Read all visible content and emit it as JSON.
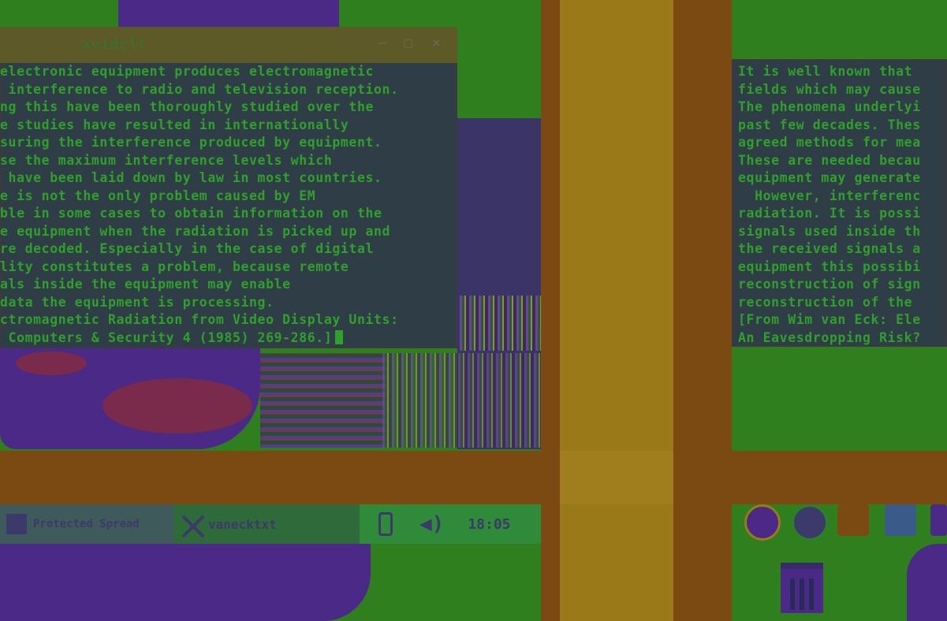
{
  "left_terminal": {
    "title": "xvidclt",
    "minimize_label": "–",
    "maximize_label": "▢",
    "close_label": "×",
    "lines": [
      "electronic equipment produces electromagnetic",
      " interference to radio and television reception.",
      "ng this have been thoroughly studied over the",
      "e studies have resulted in internationally",
      "suring the interference produced by equipment.",
      "se the maximum interference levels which",
      " have been laid down by law in most countries.",
      "e is not the only problem caused by EM",
      "ble in some cases to obtain information on the",
      "e equipment when the radiation is picked up and",
      "re decoded. Especially in the case of digital",
      "lity constitutes a problem, because remote",
      "als inside the equipment may enable",
      "data the equipment is processing.",
      "ctromagnetic Radiation from Video Display Units:",
      " Computers & Security 4 (1985) 269-286.]"
    ]
  },
  "right_terminal": {
    "lines": [
      "It is well known that",
      "fields which may cause",
      "The phenomena underlyi",
      "past few decades. Thes",
      "agreed methods for mea",
      "These are needed becau",
      "equipment may generate",
      "  However, interferenc",
      "radiation. It is possi",
      "signals used inside th",
      "the received signals a",
      "equipment this possibi",
      "reconstruction of sign",
      "reconstruction of the",
      "[From Wim van Eck: Ele",
      "An Eavesdropping Risk?"
    ]
  },
  "taskbar": {
    "task1_label": "Protected Spread",
    "task2_label": "vanecktxt",
    "clock": "18:05"
  },
  "colors": {
    "desktop_green": "#2f7f1e",
    "terminal_bg": "#2f3d46",
    "terminal_text": "#2fa02a",
    "band_brown": "#7a4a12",
    "band_gold": "#9a7a18",
    "purple": "#4a2a86"
  },
  "icons": {
    "terminal_icon": "terminal-icon",
    "phone_icon": "phone-icon",
    "speaker_icon": "speaker-icon",
    "firefox_icon": "firefox-icon",
    "browser_icon": "browser-icon",
    "files_icon": "files-icon",
    "image_icon": "image-icon",
    "trash_icon": "trash-icon"
  }
}
